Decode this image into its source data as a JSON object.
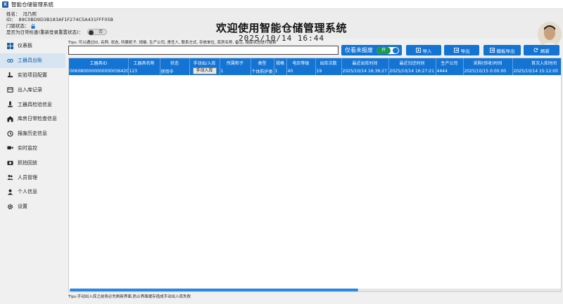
{
  "window": {
    "title": "智能仓储管理系统"
  },
  "header": {
    "name_label": "姓名：",
    "name_value": "冯乃熙",
    "id_label": "ID：",
    "id_value": "89C0BD9D3B183AF1F274C5A431FFF05B",
    "lock_label": "门锁状态：",
    "daily_check_label": "是否为日常检查(重新登录重置状态)：",
    "daily_check_state": "否",
    "title": "欢迎使用智能仓储管理系统",
    "datetime": "2025/10/14 16:44"
  },
  "sidebar": {
    "items": [
      {
        "label": "仪表板",
        "icon": "dashboard-icon"
      },
      {
        "label": "工器具台账",
        "icon": "link-icon",
        "active": true
      },
      {
        "label": "实验项目配置",
        "icon": "experiment-icon"
      },
      {
        "label": "出入库记录",
        "icon": "record-icon"
      },
      {
        "label": "工器具检验信息",
        "icon": "inspection-icon"
      },
      {
        "label": "库房日常检查信息",
        "icon": "warehouse-icon"
      },
      {
        "label": "报废历史信息",
        "icon": "scrap-icon"
      },
      {
        "label": "实时监控",
        "icon": "video-icon"
      },
      {
        "label": "抓拍回放",
        "icon": "camera-icon"
      },
      {
        "label": "人员管理",
        "icon": "users-icon"
      },
      {
        "label": "个人信息",
        "icon": "user-icon"
      },
      {
        "label": "设置",
        "icon": "gear-icon"
      }
    ]
  },
  "toolbar": {
    "tips": "Tips: 可以通过ID, 名称, 状态, 所属柜子, 规格, 生产公司, 责任人, 联系方式, 存放单位, 库房名称, 备注, 报废状态进行搜索",
    "search_value": "",
    "report_label": "仅看未报废",
    "toggle_label": "开",
    "import_label": "导入",
    "export_label": "导出",
    "template_export_label": "模板导出",
    "refresh_label": "刷新"
  },
  "table": {
    "columns": [
      "工器具ID",
      "工器具名称",
      "状态",
      "手动出/入库",
      "所属柜子",
      "类型",
      "规格",
      "电压等级",
      "出库次数",
      "最近出库时间",
      "最近归还时间",
      "生产公司",
      "采购(验收)时间",
      "首次入库时间"
    ],
    "rows": [
      {
        "id": "006080000000000003642097",
        "name": "123",
        "status": "使用中",
        "action": "手动入库",
        "cabinet": "1",
        "type": "个体防护类",
        "spec": "1",
        "voltage": "40",
        "count": "19",
        "last_out": "2025/10/14 16:36:27",
        "last_return": "2025/10/14 16:27:21",
        "company": "4444",
        "purchase": "2025/10/15 0:00:00",
        "first_in": "2025/10/14 15:12:00"
      }
    ]
  },
  "footer": {
    "tips": "Tips:手动出入库之前务必先刷新界面,防止界面缓存造成手动出入库失败"
  },
  "colors": {
    "accent": "#1474d4",
    "active_nav_bg": "#d7e5f3",
    "toggle_green": "#1a9a4a"
  }
}
